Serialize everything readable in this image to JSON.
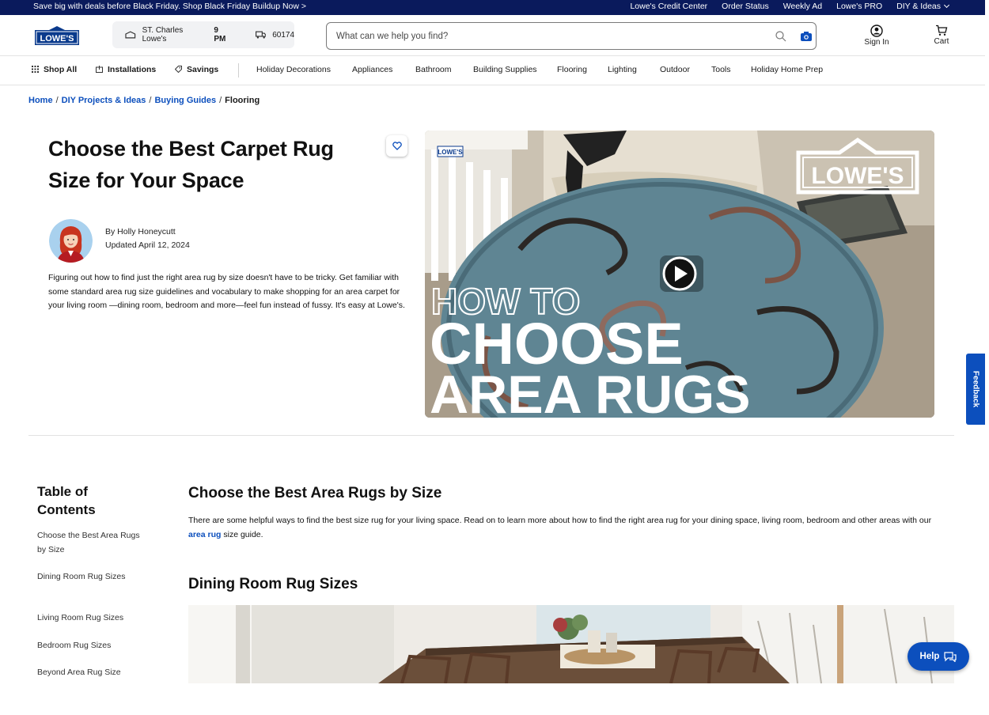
{
  "promo": {
    "deal": "Save big with deals before Black Friday. Shop Black Friday Buildup Now >",
    "links": [
      "Lowe's Credit Center",
      "Order Status",
      "Weekly Ad",
      "Lowe's PRO",
      "DIY & Ideas"
    ]
  },
  "header": {
    "logo_text": "LOWE'S",
    "store_name": "ST. Charles Lowe's",
    "store_hours": "9 PM",
    "zip": "60174",
    "search_placeholder": "What can we help you find?",
    "sign_in": "Sign In",
    "cart": "Cart"
  },
  "nav": {
    "shop_all": "Shop All",
    "installations": "Installations",
    "savings": "Savings",
    "categories": [
      "Holiday Decorations",
      "Appliances",
      "Bathroom",
      "Building Supplies",
      "Flooring",
      "Lighting",
      "Outdoor",
      "Tools",
      "Holiday Home Prep"
    ]
  },
  "breadcrumb": {
    "items": [
      "Home",
      "DIY Projects & Ideas",
      "Buying Guides"
    ],
    "current": "Flooring"
  },
  "article": {
    "title": "Choose the Best Carpet Rug Size for Your Space",
    "author": "By Holly Honeycutt",
    "updated": "Updated April 12, 2024",
    "intro": "Figuring out how to find just the right area rug by size doesn't have to be tricky. Get familiar with some standard area rug size guidelines and vocabulary to make shopping for an area carpet for your living room —dining room, bedroom and more—feel fun instead of fussy. It's easy at Lowe's."
  },
  "video": {
    "line1": "HOW TO",
    "line2": "CHOOSE",
    "line3": "AREA RUGS",
    "brand": "LOWE'S",
    "tiny_brand": "LOWE'S"
  },
  "toc": {
    "title": "Table of Contents",
    "items": [
      "Choose the Best Area Rugs by Size",
      "Dining Room Rug Sizes",
      "Living Room Rug Sizes",
      "Bedroom Rug Sizes",
      "Beyond Area Rug Size"
    ]
  },
  "sections": {
    "s1_title": "Choose the Best Area Rugs by Size",
    "s1_text_before": "There are some helpful ways to find the best size rug for your living space. Read on to learn more about how to find the right area rug for your dining space, living room, bedroom and other areas with our ",
    "s1_link": "area rug",
    "s1_text_after": " size guide.",
    "s2_title": "Dining Room Rug Sizes"
  },
  "widgets": {
    "feedback": "Feedback",
    "help": "Help"
  },
  "colors": {
    "brand_navy": "#0a1a5c",
    "link_blue": "#0c4fbd"
  }
}
